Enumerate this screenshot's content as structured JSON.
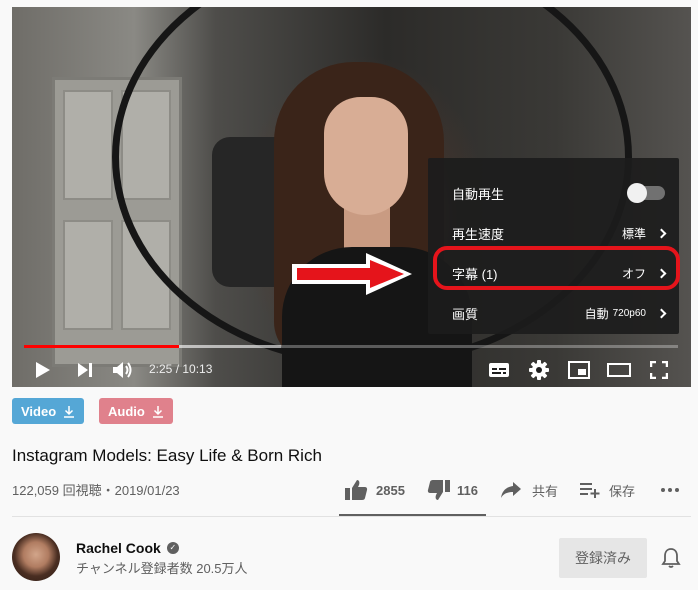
{
  "player": {
    "time_display": "2:25 / 10:13",
    "progress": {
      "played_fraction": 0.237,
      "buffered_fraction": 0.393
    },
    "settings_menu": {
      "items": [
        {
          "label": "自動再生",
          "value": "",
          "type": "toggle",
          "toggle_on": false
        },
        {
          "label": "再生速度",
          "value": "標準",
          "type": "submenu"
        },
        {
          "label": "字幕 (1)",
          "value": "オフ",
          "type": "submenu",
          "highlighted": true
        },
        {
          "label": "画質",
          "value": "自動",
          "value_suffix": "720p60",
          "type": "submenu"
        }
      ]
    },
    "controls": {
      "play_icon": "play-icon",
      "next_icon": "next-icon",
      "volume_icon": "volume-icon",
      "subtitles_icon": "subtitles-icon",
      "settings_icon": "gear-icon",
      "miniplayer_icon": "miniplayer-icon",
      "theater_icon": "theater-icon",
      "fullscreen_icon": "fullscreen-icon"
    },
    "colors": {
      "progress": "#ff0000",
      "highlight": "#e5141b",
      "arrow": "#e5141b"
    }
  },
  "downloads": [
    {
      "label": "Video",
      "color": "#55a7d6"
    },
    {
      "label": "Audio",
      "color": "#e0818c"
    }
  ],
  "video": {
    "title": "Instagram Models: Easy Life & Born Rich",
    "meta": "122,059 回視聴・2019/01/23",
    "likes": "2855",
    "dislikes": "116",
    "share_label": "共有",
    "save_label": "保存"
  },
  "channel": {
    "name": "Rachel Cook",
    "subscribers": "チャンネル登録者数 20.5万人",
    "subscribe_label": "登録済み"
  }
}
